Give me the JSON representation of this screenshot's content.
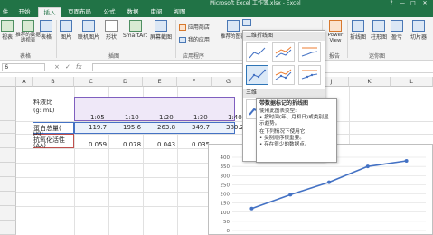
{
  "window": {
    "title": "Microsoft Excel 工作簿.xlsx - Excel",
    "controls": [
      "?",
      "—",
      "□",
      "✕"
    ]
  },
  "tabs": [
    {
      "label": "件",
      "active": false
    },
    {
      "label": "开始",
      "active": false
    },
    {
      "label": "插入",
      "active": true
    },
    {
      "label": "页面布局",
      "active": false
    },
    {
      "label": "公式",
      "active": false
    },
    {
      "label": "数据",
      "active": false
    },
    {
      "label": "审阅",
      "active": false
    },
    {
      "label": "视图",
      "active": false
    }
  ],
  "ribbon": {
    "buttons": [
      "视表",
      "推荐的数据透视表",
      "表格",
      "图片",
      "联机图片",
      "形状",
      "SmartArt",
      "屏幕截图",
      "应用商店",
      "我的应用",
      "推荐的图表",
      "Power View",
      "折线图",
      "柱形图",
      "盈亏",
      "切片器"
    ],
    "groups": [
      "表格",
      "插图",
      "应用程序",
      "报告",
      "迷你图"
    ]
  },
  "formula_bar": {
    "name_box": "6",
    "cancel": "×",
    "confirm": "✓",
    "fx": "fx",
    "value": ""
  },
  "columns": [
    "A",
    "B",
    "C",
    "D",
    "E",
    "F",
    "G",
    "H",
    "I",
    "J",
    "K",
    "L"
  ],
  "sheet": {
    "label_ratio": "料液比",
    "label_ratio_unit": "(g: mL)",
    "ratios": [
      "1:05",
      "1:10",
      "1:20",
      "1:30",
      "1:40"
    ],
    "label_sugar": "蛋白总量(",
    "label_sugar2": "μg)",
    "sugar": [
      "119.7",
      "195.6",
      "263.8",
      "349.7",
      "380.2"
    ],
    "label_activity": "抗氧化活性",
    "label_activity2": "(ΔA)",
    "activity": [
      "0.059",
      "0.078",
      "0.043",
      "0.035",
      ""
    ]
  },
  "dropdown": {
    "section_2d": "二维折线图",
    "section_3d": "三维"
  },
  "tooltip": {
    "title": "带数据标记的折线图",
    "line1": "使用此图表类型:",
    "line2": "• 按时间(年、月和日)或类别显示趋势。",
    "line3": "在下列情况下使用它:",
    "line4": "• 类别顺序很重要。",
    "line5": "• 存在很少的数据点。"
  },
  "chart_data": {
    "type": "line",
    "x": [
      1,
      2,
      3,
      4,
      5
    ],
    "values": [
      119.7,
      195.6,
      263.8,
      349.7,
      380.2
    ],
    "yticks": [
      "400",
      "350",
      "300",
      "250",
      "200",
      "150",
      "100",
      "50",
      "0"
    ],
    "ylim": [
      0,
      400
    ],
    "color": "#4472c4",
    "grid": true
  }
}
